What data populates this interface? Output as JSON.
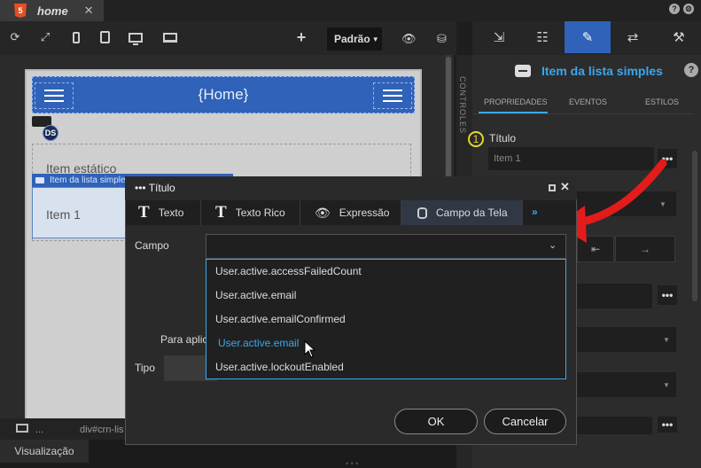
{
  "editor": {
    "tab": {
      "title": "home",
      "close": "✕"
    },
    "toolbar": {
      "device": "Padrão",
      "add": "+"
    },
    "canvas": {
      "header_title": "{Home}",
      "ds_badge": "DS",
      "static_item": "Item estático",
      "selected_component": "Item da lista simples",
      "item_1": "Item 1"
    },
    "path": {
      "dots": "...",
      "text": "div#crn-lis"
    },
    "bottom_tab": "Visualização"
  },
  "right_panel": {
    "side_label": "CONTROLES",
    "component_title": "Item da lista simples",
    "help": "?",
    "tabs": [
      "PROPRIEDADES",
      "EVENTOS",
      "ESTILOS"
    ],
    "step_number": "1",
    "titulo_label": "Título",
    "titulo_value": "Item 1",
    "more": "•••"
  },
  "dialog": {
    "title": "••• Título",
    "close": "✕",
    "tabs": [
      {
        "label": "Texto",
        "icon": "text-T-icon"
      },
      {
        "label": "Texto Rico",
        "icon": "text-T-icon"
      },
      {
        "label": "Expressão",
        "icon": "eye-icon"
      },
      {
        "label": "Campo da Tela",
        "icon": "database-icon"
      }
    ],
    "more_tabs": "»",
    "campo_label": "Campo",
    "campo_value": "",
    "aplicar_label": "Para aplic",
    "tipo_label": "Tipo",
    "dropdown_options": [
      "User.active.accessFailedCount",
      "User.active.email",
      "User.active.emailConfirmed",
      "User.active.email",
      "User.active.lockoutEnabled"
    ],
    "hovered_option_index": 3,
    "ok": "OK",
    "cancel": "Cancelar"
  },
  "colors": {
    "accent_blue": "#2f62b8",
    "link_blue": "#3ba7ee",
    "annotation_red": "#e41b1b",
    "badge_yellow": "#e6d52b"
  }
}
